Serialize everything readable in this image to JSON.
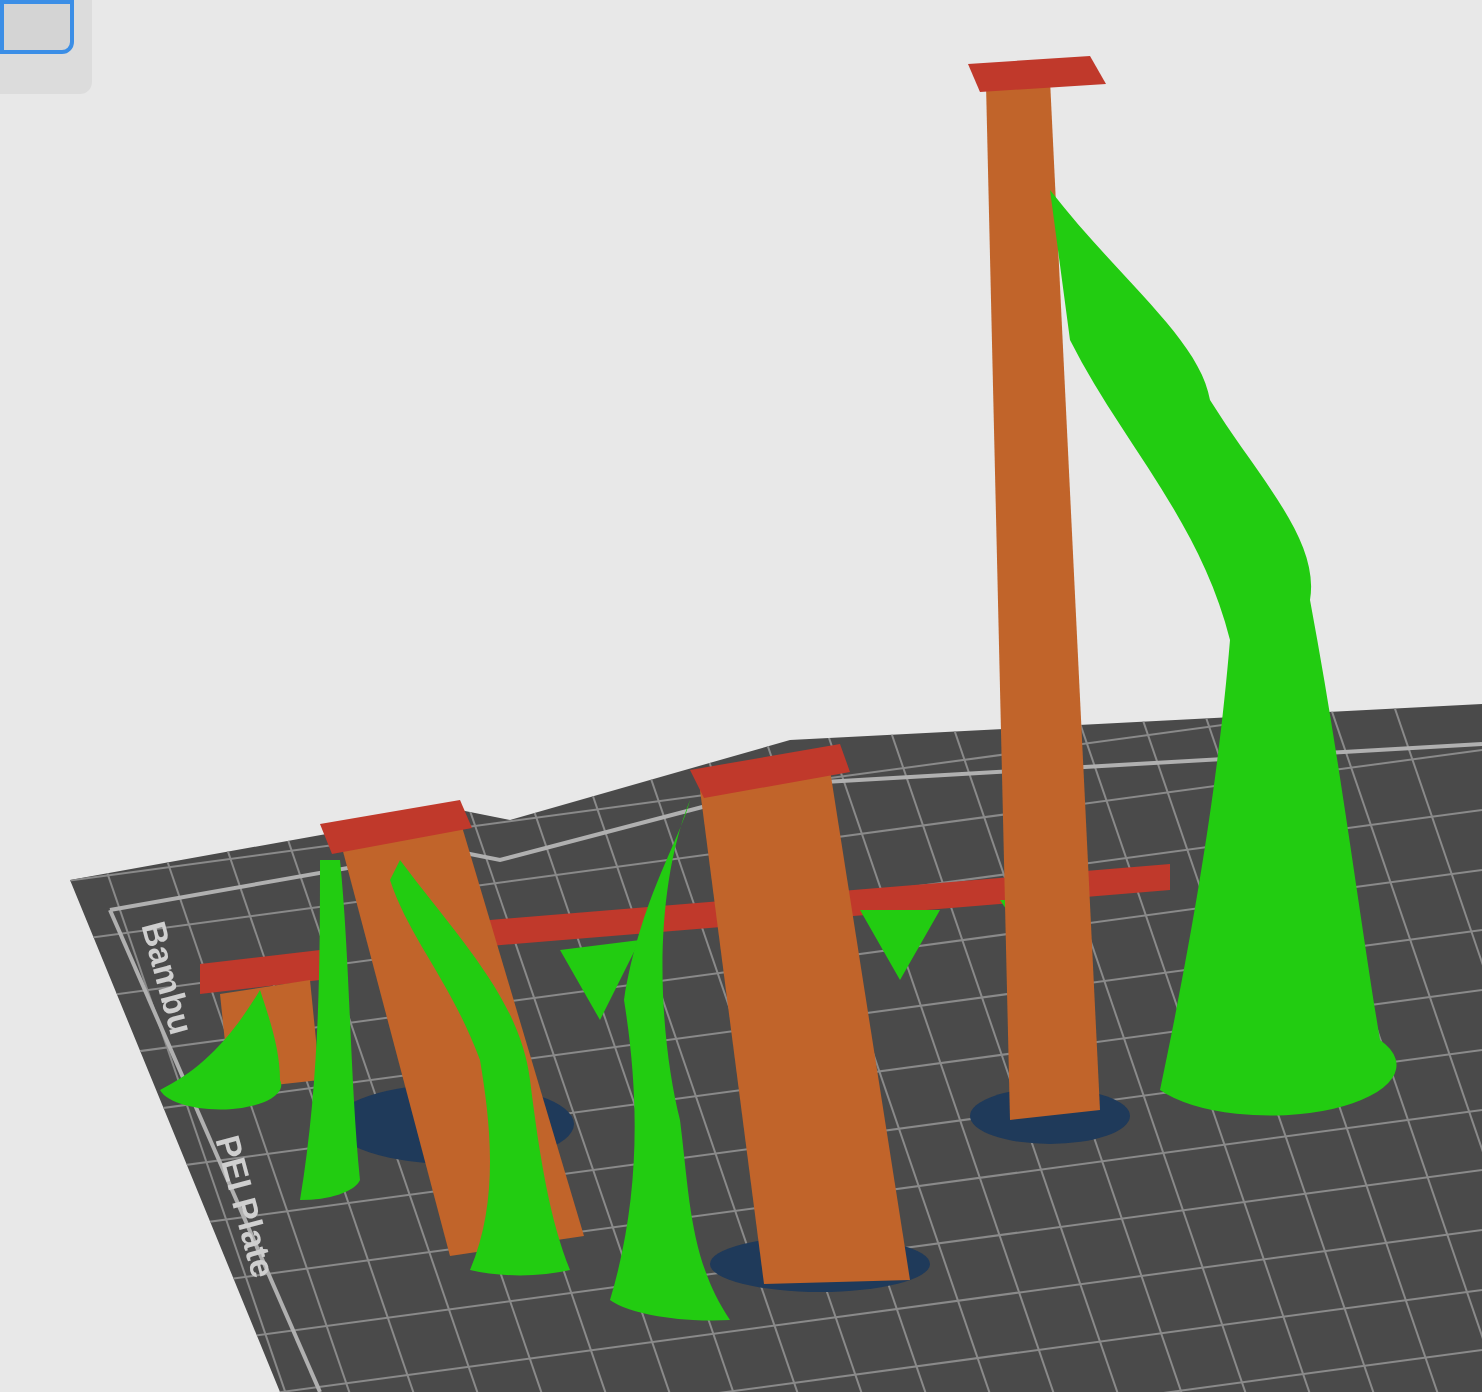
{
  "toolbar": {
    "buttons": [
      {
        "selected": true
      }
    ]
  },
  "plate": {
    "labels": [
      "Bambu",
      "PEI Plate"
    ]
  }
}
